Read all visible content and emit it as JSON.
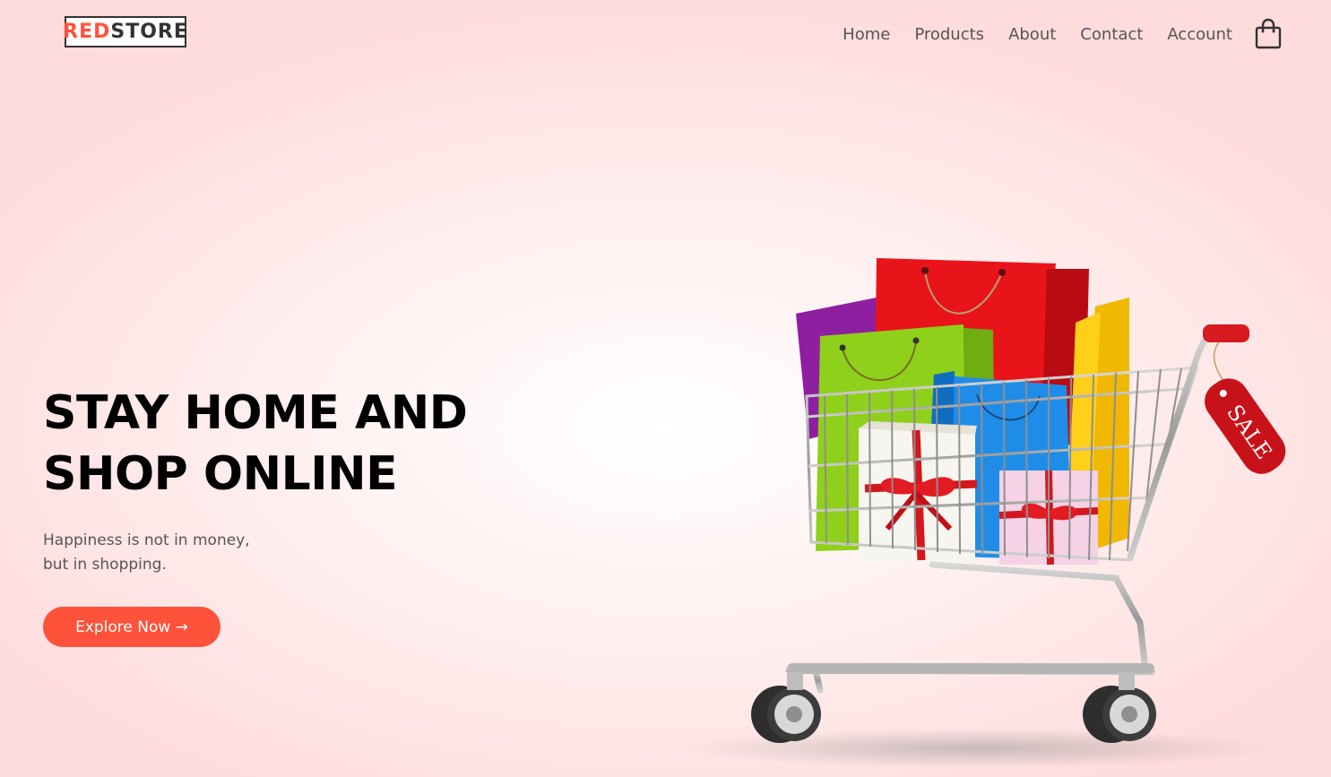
{
  "brand": {
    "logo_part1": "RED",
    "logo_part2": "STORE",
    "accent_color": "#ff523b"
  },
  "nav": {
    "items": [
      {
        "label": "Home"
      },
      {
        "label": "Products"
      },
      {
        "label": "About"
      },
      {
        "label": "Contact"
      },
      {
        "label": "Account"
      }
    ],
    "cart_icon": "shopping-bag-icon"
  },
  "hero": {
    "title_line1": "STAY HOME AND",
    "title_line2": "SHOP ONLINE",
    "subtitle_line1": "Happiness is not in money,",
    "subtitle_line2": "but in shopping.",
    "cta_label": "Explore Now →",
    "image": {
      "icon": "shopping-cart-with-gifts-image",
      "tag_text": "SALE"
    }
  }
}
